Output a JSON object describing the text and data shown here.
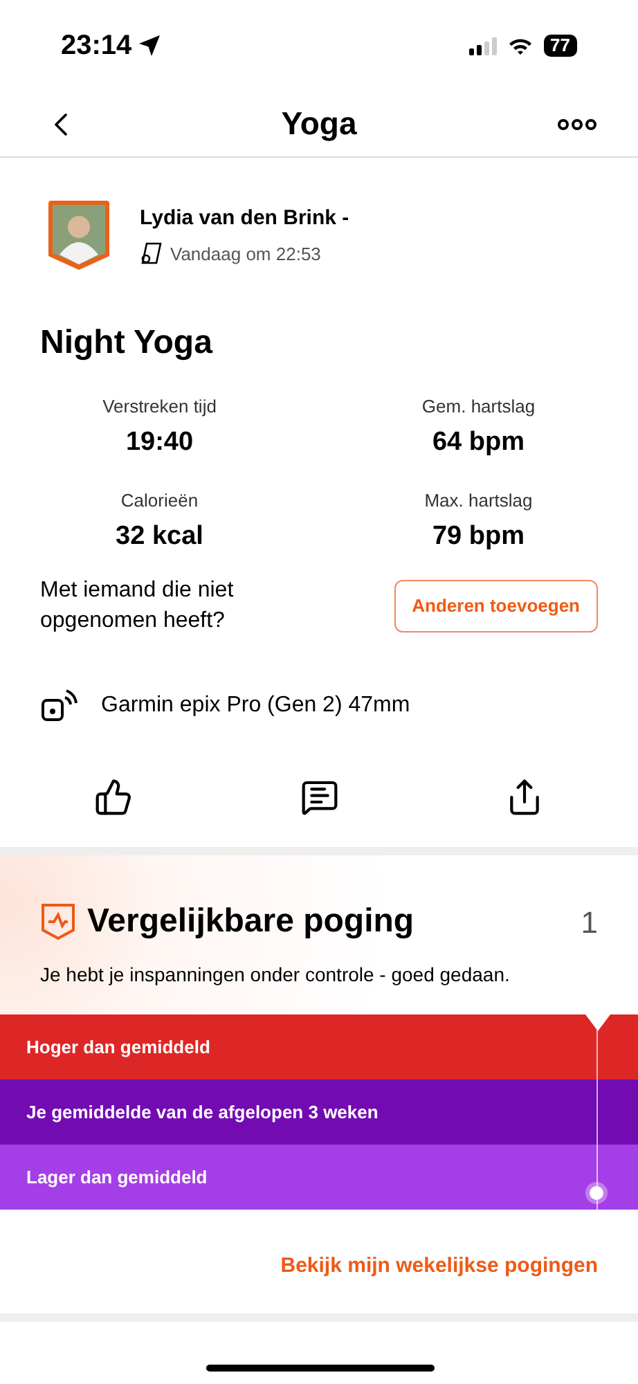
{
  "status_bar": {
    "time": "23:14",
    "battery": "77"
  },
  "header": {
    "title": "Yoga"
  },
  "athlete": {
    "name": "Lydia van den Brink -",
    "timestamp": "Vandaag om 22:53"
  },
  "activity": {
    "title": "Night Yoga",
    "stats": [
      {
        "label": "Verstreken tijd",
        "value": "19:40"
      },
      {
        "label": "Gem. hartslag",
        "value": "64 bpm"
      },
      {
        "label": "Calorieën",
        "value": "32 kcal"
      },
      {
        "label": "Max. hartslag",
        "value": "79 bpm"
      }
    ],
    "prompt": "Met iemand die niet opgenomen heeft?",
    "add_button": "Anderen toevoegen",
    "device": "Garmin epix Pro (Gen 2) 47mm"
  },
  "effort": {
    "title": "Vergelijkbare poging",
    "count": "1",
    "message": "Je hebt je inspanningen onder controle - goed gedaan.",
    "bands": [
      {
        "label": "Hoger dan gemiddeld",
        "color": "#dd2727",
        "selected": false
      },
      {
        "label": "Je gemiddelde van de afgelopen 3 weken",
        "color": "#730bb3",
        "selected": false
      },
      {
        "label": "Lager dan gemiddeld",
        "color": "#a43ee6",
        "selected": true
      }
    ],
    "link": "Bekijk mijn wekelijkse pogingen"
  }
}
